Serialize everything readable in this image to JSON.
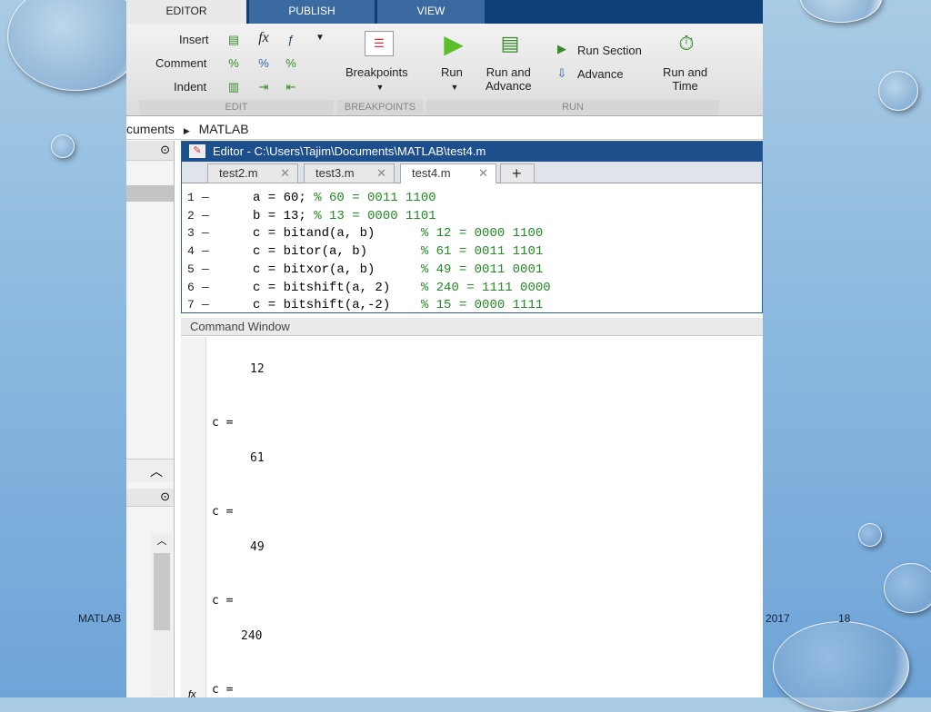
{
  "ribbon": {
    "tabs": [
      "EDITOR",
      "PUBLISH",
      "VIEW"
    ],
    "edit": {
      "insert": "Insert",
      "comment": "Comment",
      "indent": "Indent",
      "section": "EDIT"
    },
    "breakpoints": {
      "label": "Breakpoints",
      "section": "BREAKPOINTS"
    },
    "run": {
      "run": "Run",
      "run_advance": "Run and\nAdvance",
      "run_section": "Run Section",
      "advance": "Advance",
      "run_time": "Run and\nTime",
      "section": "RUN"
    }
  },
  "breadcrumb": [
    "cuments",
    "MATLAB"
  ],
  "editor": {
    "title": "Editor - C:\\Users\\Tajim\\Documents\\MATLAB\\test4.m",
    "tabs": [
      "test2.m",
      "test3.m",
      "test4.m"
    ],
    "lines": [
      {
        "n": "1",
        "code": "a = 60; ",
        "comment": "% 60 = 0011 1100"
      },
      {
        "n": "2",
        "code": "b = 13; ",
        "comment": "% 13 = 0000 1101"
      },
      {
        "n": "3",
        "code": "c = bitand(a, b)      ",
        "comment": "% 12 = 0000 1100"
      },
      {
        "n": "4",
        "code": "c = bitor(a, b)       ",
        "comment": "% 61 = 0011 1101"
      },
      {
        "n": "5",
        "code": "c = bitxor(a, b)      ",
        "comment": "% 49 = 0011 0001"
      },
      {
        "n": "6",
        "code": "c = bitshift(a, 2)    ",
        "comment": "% 240 = 1111 0000"
      },
      {
        "n": "7",
        "code": "c = bitshift(a,-2)    ",
        "comment": "% 15 = 0000 1111"
      }
    ]
  },
  "command_window": {
    "title": "Command Window",
    "output": [
      "12",
      "c =",
      "61",
      "c =",
      "49",
      "c =",
      "240",
      "c ="
    ]
  },
  "footer": {
    "left": "MATLAB",
    "date": "2017",
    "page": "18"
  }
}
